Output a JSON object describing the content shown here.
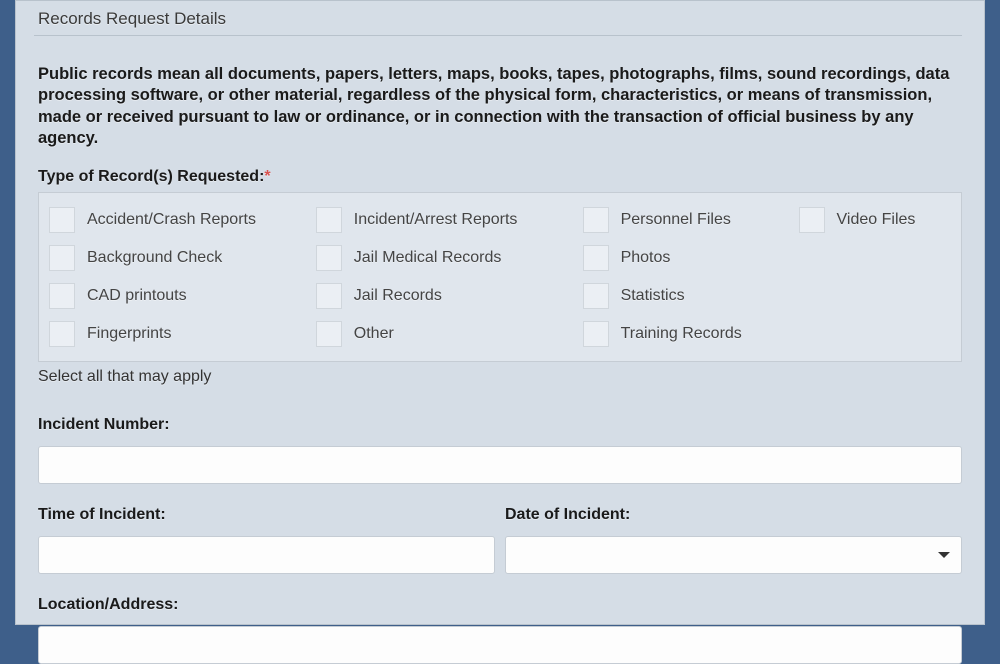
{
  "section_title": "Records Request Details",
  "description": "Public records mean all documents, papers, letters, maps, books, tapes, photographs, films, sound recordings, data processing software, or other material, regardless of the physical form, characteristics, or means of transmission, made or received pursuant to law or ordinance, or in connection with the transaction of official business by any agency.",
  "type_of_records_label": "Type of Record(s) Requested:",
  "checkboxes": [
    "Accident/Crash Reports",
    "Incident/Arrest Reports",
    "Personnel Files",
    "Video Files",
    "Background Check",
    "Jail Medical Records",
    "Photos",
    "",
    "CAD printouts",
    "Jail Records",
    "Statistics",
    "",
    "Fingerprints",
    "Other",
    "Training Records",
    ""
  ],
  "helper_text": "Select all that may apply",
  "incident_number_label": "Incident Number:",
  "time_of_incident_label": "Time of Incident:",
  "date_of_incident_label": "Date of Incident:",
  "location_address_label": "Location/Address:"
}
